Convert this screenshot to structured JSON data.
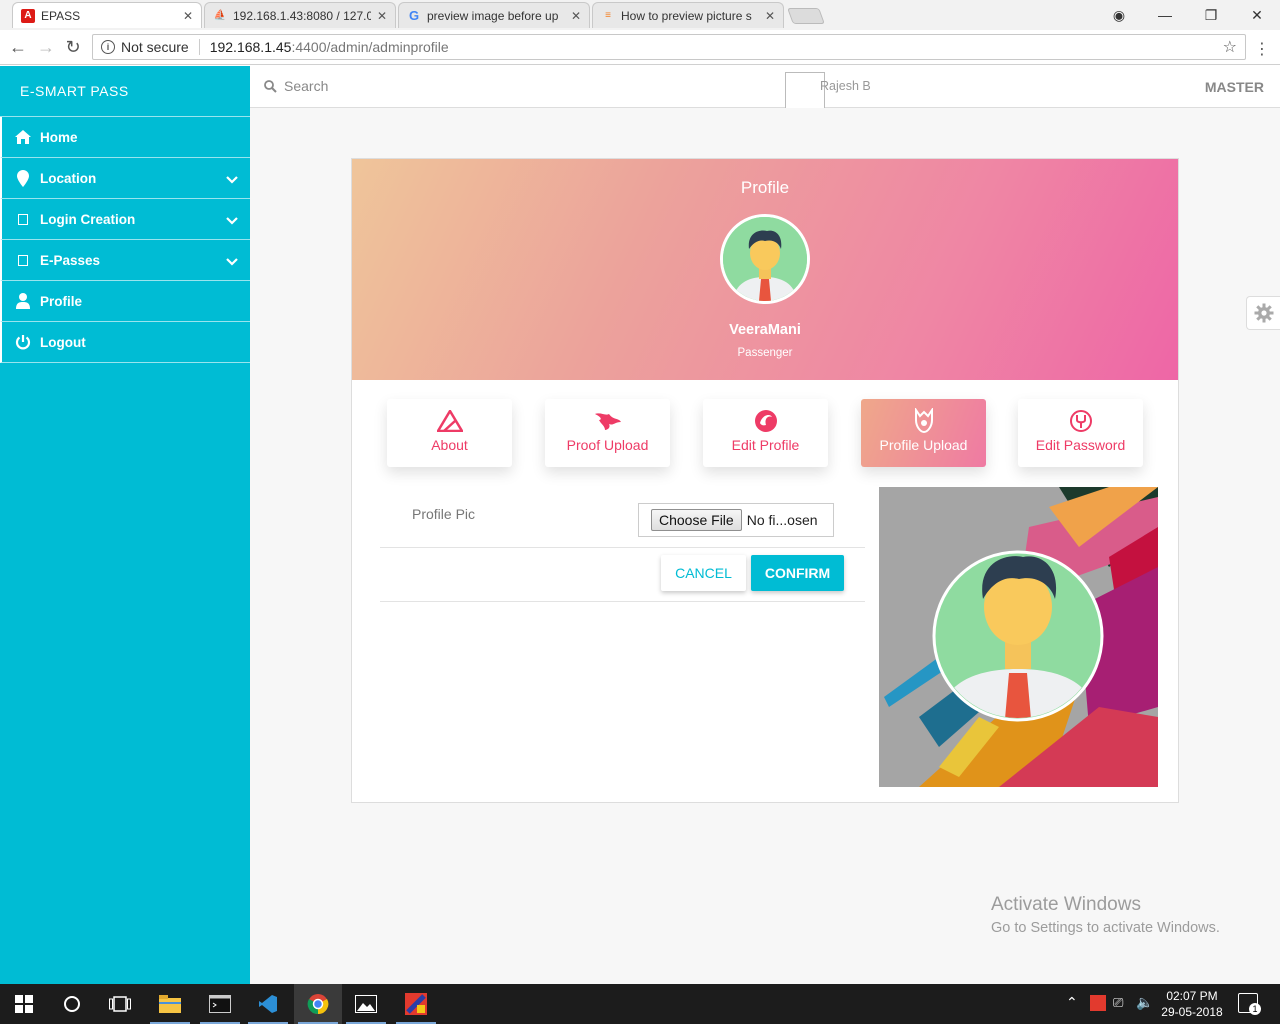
{
  "browser": {
    "tabs": [
      {
        "title": "EPASS",
        "icon": "angular-icon",
        "active": true
      },
      {
        "title": "192.168.1.43:8080 / 127.0",
        "icon": "phpmyadmin-icon",
        "active": false
      },
      {
        "title": "preview image before up",
        "icon": "google-icon",
        "active": false
      },
      {
        "title": "How to preview picture s",
        "icon": "stackoverflow-icon",
        "active": false
      }
    ],
    "security_label": "Not secure",
    "url_host": "192.168.1.45",
    "url_path": ":4400/admin/adminprofile"
  },
  "sidebar": {
    "brand": "E-SMART PASS",
    "items": [
      {
        "label": "Home",
        "icon": "home-icon",
        "expandable": false
      },
      {
        "label": "Location",
        "icon": "location-pin-icon",
        "expandable": true
      },
      {
        "label": "Login Creation",
        "icon": "square-icon",
        "expandable": true
      },
      {
        "label": "E-Passes",
        "icon": "square-icon",
        "expandable": true
      },
      {
        "label": "Profile",
        "icon": "user-icon",
        "expandable": false
      },
      {
        "label": "Logout",
        "icon": "power-icon",
        "expandable": false
      }
    ]
  },
  "topbar": {
    "search_placeholder": "Search",
    "user_name": "Rajesh B",
    "role_label": "MASTER"
  },
  "profile": {
    "title": "Profile",
    "name": "VeeraMani",
    "role": "Passenger",
    "tabs": [
      {
        "label": "About",
        "icon": "about-icon",
        "active": false
      },
      {
        "label": "Proof Upload",
        "icon": "proof-upload-icon",
        "active": false
      },
      {
        "label": "Edit Profile",
        "icon": "edit-profile-icon",
        "active": false
      },
      {
        "label": "Profile Upload",
        "icon": "profile-upload-icon",
        "active": true
      },
      {
        "label": "Edit Password",
        "icon": "edit-password-icon",
        "active": false
      }
    ],
    "form": {
      "field_label": "Profile Pic",
      "choose_button": "Choose File",
      "file_status": "No fi...osen",
      "cancel_label": "CANCEL",
      "confirm_label": "CONFIRM"
    }
  },
  "watermark": {
    "line1": "Activate Windows",
    "line2": "Go to Settings to activate Windows."
  },
  "taskbar": {
    "time": "02:07 PM",
    "date": "29-05-2018",
    "notification_count": "1"
  },
  "colors": {
    "accent": "#00bcd4",
    "tab_text": "#ee3b66",
    "hero_start": "#efc59a",
    "hero_end": "#ee66a6"
  }
}
